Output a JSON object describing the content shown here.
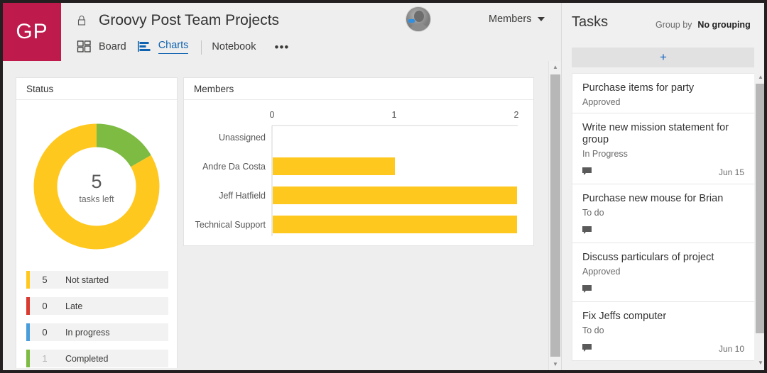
{
  "brand": {
    "initials": "GP",
    "color": "#bf1a4c"
  },
  "header": {
    "lock_icon": "lock-icon",
    "plan_title": "Groovy Post Team Projects",
    "members_label": "Members",
    "members_caret": "chevron-down-icon",
    "avatar_alt": "user-avatar"
  },
  "tabs": [
    {
      "label": "Board",
      "icon": "board-grid-icon",
      "active": false
    },
    {
      "label": "Charts",
      "icon": "bar-chart-icon",
      "active": true
    },
    {
      "label": "Notebook",
      "icon": "",
      "active": false
    }
  ],
  "tab_more": "•••",
  "charts": {
    "status_card_title": "Status",
    "members_card_title": "Members"
  },
  "chart_data": [
    {
      "type": "pie",
      "title": "Status",
      "subtitle": "donut",
      "center_value": "5",
      "center_label": "tasks left",
      "categories": [
        "Not started",
        "Late",
        "In progress",
        "Completed"
      ],
      "values": [
        5,
        0,
        0,
        1
      ],
      "colors": [
        "#ffc81e",
        "#d93b30",
        "#4a9ddb",
        "#7dbb42"
      ],
      "legend_position": "below",
      "legend": [
        {
          "count": "5",
          "label": "Not started",
          "color": "#ffc81e",
          "dim": false
        },
        {
          "count": "0",
          "label": "Late",
          "color": "#d93b30",
          "dim": false
        },
        {
          "count": "0",
          "label": "In progress",
          "color": "#4a9ddb",
          "dim": false
        },
        {
          "count": "1",
          "label": "Completed",
          "color": "#7dbb42",
          "dim": true
        }
      ]
    },
    {
      "type": "bar",
      "orientation": "horizontal",
      "title": "Members",
      "categories": [
        "Unassigned",
        "Andre Da Costa",
        "Jeff Hatfield",
        "Technical Support"
      ],
      "values": [
        0,
        1,
        2,
        2
      ],
      "bar_color": "#ffc81e",
      "xlabel": "",
      "ylabel": "",
      "xlim": [
        0,
        2
      ],
      "xticks": [
        "0",
        "1",
        "2"
      ],
      "grid": false
    }
  ],
  "tasks_panel": {
    "title": "Tasks",
    "group_by_label": "Group by",
    "group_by_value": "No grouping",
    "group_by_caret": "chevron-down-icon",
    "add_button_label": "+",
    "items": [
      {
        "title": "Purchase items for party",
        "status": "Approved",
        "has_comment": false,
        "date": ""
      },
      {
        "title": "Write new mission statement for group",
        "status": "In Progress",
        "has_comment": true,
        "date": "Jun 15"
      },
      {
        "title": "Purchase new mouse for Brian",
        "status": "To do",
        "has_comment": true,
        "date": ""
      },
      {
        "title": "Discuss particulars of project",
        "status": "Approved",
        "has_comment": true,
        "date": ""
      },
      {
        "title": "Fix Jeffs computer",
        "status": "To do",
        "has_comment": true,
        "date": "Jun 10"
      }
    ]
  },
  "scrollbars": {
    "up_arrow": "chevron-up-icon",
    "down_arrow": "chevron-down-icon"
  }
}
